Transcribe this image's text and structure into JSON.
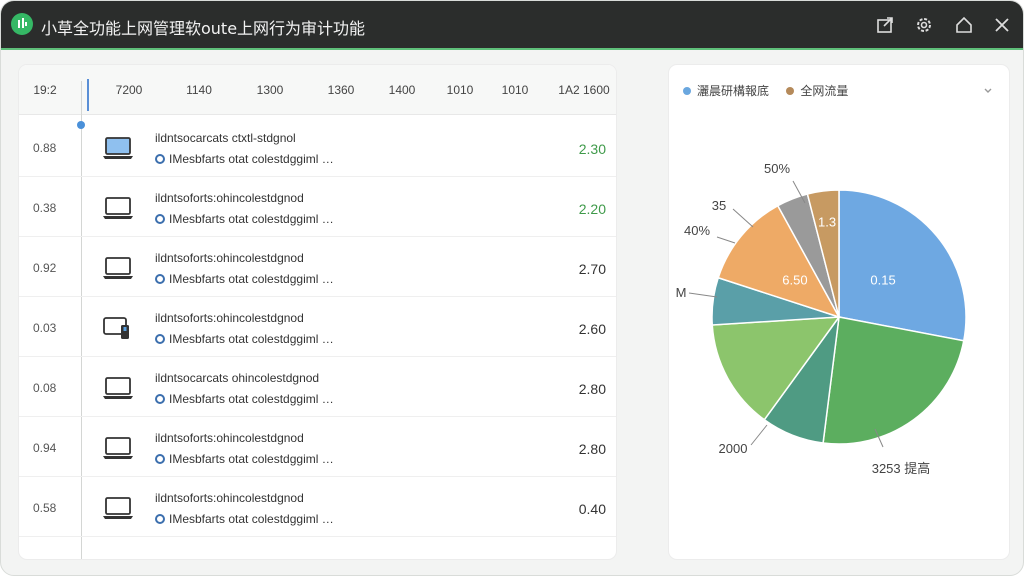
{
  "window": {
    "title": "小草全功能上网管理软oute上网行为审计功能",
    "controls": [
      "export-icon",
      "settings-icon",
      "home-icon",
      "close-icon"
    ]
  },
  "timeline": {
    "axis_labels": [
      "19:2",
      "7200",
      "1140",
      "1300",
      "1360",
      "1400",
      "1010",
      "1010",
      "1A2 1600"
    ]
  },
  "rows": [
    {
      "time": "0.88",
      "title": "ildntsocarcats ctxtl-stdgnol",
      "sub": "IMesbfarts otat colestdggiml …",
      "value": "2.30",
      "value_color": "green",
      "device": "laptop-icon"
    },
    {
      "time": "0.38",
      "title": "ildntsoforts:ohincolestdgnod",
      "sub": "IMesbfarts otat colestdggiml …",
      "value": "2.20",
      "value_color": "green",
      "device": "laptop-icon"
    },
    {
      "time": "0.92",
      "title": "ildntsoforts:ohincolestdgnod",
      "sub": "IMesbfarts otat colestdggiml …",
      "value": "2.70",
      "value_color": "default",
      "device": "laptop-icon"
    },
    {
      "time": "0.03",
      "title": "ildntsoforts:ohincolestdgnod",
      "sub": "IMesbfarts otat colestdggiml …",
      "value": "2.60",
      "value_color": "default",
      "device": "desktop-icon"
    },
    {
      "time": "0.08",
      "title": "ildntsocarcats ohincolestdgnod",
      "sub": "IMesbfarts otat colestdggiml …",
      "value": "2.80",
      "value_color": "default",
      "device": "laptop-icon"
    },
    {
      "time": "0.94",
      "title": "ildntsoforts:ohincolestdgnod",
      "sub": "IMesbfarts otat colestdggiml …",
      "value": "2.80",
      "value_color": "default",
      "device": "laptop-icon"
    },
    {
      "time": "0.58",
      "title": "ildntsoforts:ohincolestdgnod",
      "sub": "IMesbfarts otat colestdggiml …",
      "value": "0.40",
      "value_color": "default",
      "device": "laptop-icon"
    }
  ],
  "colors": {
    "accent_green": "#35b865",
    "value_green": "#3f9a4a",
    "titlebar": "#2b2d2c"
  },
  "chart_data": {
    "type": "pie",
    "legend": [
      {
        "name": "灑晨研構報底",
        "color": "#6aa7df"
      },
      {
        "name": "全网流量",
        "color": "#b58a5a"
      }
    ],
    "legend_placement": "top-left",
    "slices": [
      {
        "value": 28,
        "color": "#6ea8e2",
        "label": "0.15"
      },
      {
        "value": 24,
        "color": "#5cae5f",
        "label": ""
      },
      {
        "value": 8,
        "color": "#4f9b83",
        "label": ""
      },
      {
        "value": 14,
        "color": "#8cc56c",
        "label": ""
      },
      {
        "value": 6,
        "color": "#5a9fa8",
        "label": ""
      },
      {
        "value": 12,
        "color": "#eeaa66",
        "label": "6.50"
      },
      {
        "value": 4,
        "color": "#9a9a9a",
        "label": ""
      },
      {
        "value": 4,
        "color": "#c79a62",
        "label": "1.3"
      }
    ],
    "annotations": [
      "50%",
      "35",
      "40%",
      "M",
      "2000",
      "3253 提高"
    ]
  }
}
